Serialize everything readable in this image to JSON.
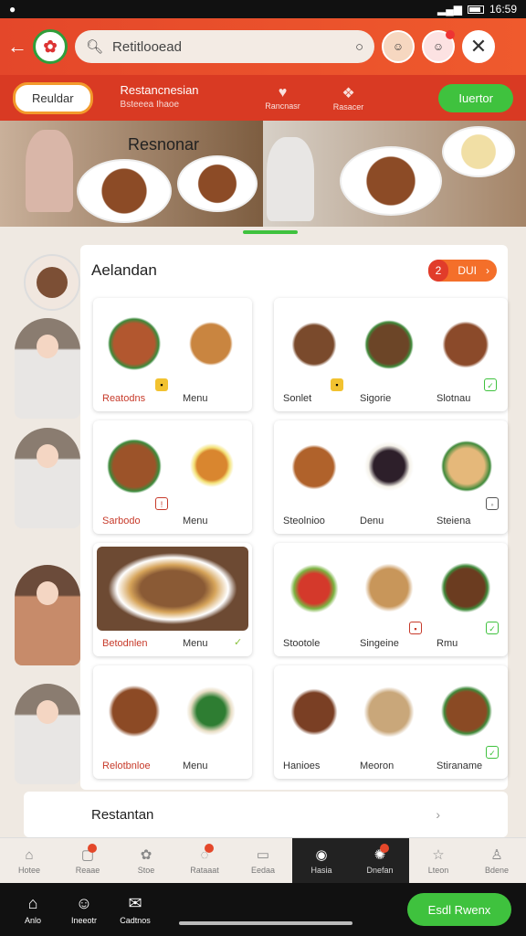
{
  "status_bar": {
    "time": "16:59"
  },
  "header": {
    "search_text": "Retitlooead"
  },
  "sub_bar": {
    "pill": "Reuldar",
    "title": "Restancnesian",
    "subtitle": "Bsteeea Ihaoe",
    "icon1_label": "Rancnasr",
    "icon2_label": "Rasacer",
    "button": "Iuertor"
  },
  "banner": {
    "title": "Resnonar"
  },
  "panel": {
    "title": "Aelandan",
    "ctrl_a": "2",
    "ctrl_b": "DUI"
  },
  "cards": [
    {
      "labels": [
        "Reatodns",
        "Menu"
      ]
    },
    {
      "labels": [
        "Sonlet",
        "Sigorie",
        "Slotnau"
      ]
    },
    {
      "labels": [
        "Sarbodo",
        "Menu"
      ]
    },
    {
      "labels": [
        "Steolnioo",
        "Denu",
        "Steiena"
      ]
    },
    {
      "labels": [
        "Betodnlen",
        "Menu"
      ]
    },
    {
      "labels": [
        "Stootole",
        "Singeine",
        "Rmu"
      ]
    },
    {
      "labels": [
        "Relotbnloe",
        "Menu"
      ]
    },
    {
      "labels": [
        "Hanioes",
        "Meoron",
        "Stiraname"
      ]
    }
  ],
  "bottom_row": {
    "title": "Restantan"
  },
  "tabs": [
    "Hotee",
    "Reaae",
    "Stoe",
    "Rataaat",
    "Eedaa",
    "Hasia",
    "Dnefan",
    "Lteon",
    "Bdene"
  ],
  "nav": [
    {
      "icon": "home-icon",
      "label": "Anlo"
    },
    {
      "icon": "smile-icon",
      "label": "Ineeotr"
    },
    {
      "icon": "chat-icon",
      "label": "Cadtnos"
    }
  ],
  "cta": "Esdl Rwenx"
}
